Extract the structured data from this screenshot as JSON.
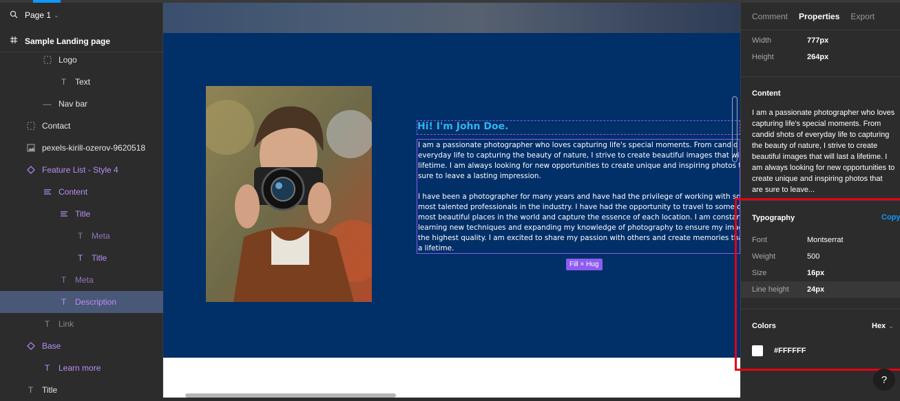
{
  "page_selector": {
    "label": "Page 1"
  },
  "frame": {
    "label": "Sample Landing page"
  },
  "layers": [
    {
      "label": "Logo",
      "icon": "dashed-frame-icon"
    },
    {
      "label": "Text",
      "icon": "text-icon"
    },
    {
      "label": "Nav bar",
      "icon": "line-icon"
    },
    {
      "label": "Contact",
      "icon": "dashed-frame-icon"
    },
    {
      "label": "pexels-kirill-ozerov-9620518",
      "icon": "image-icon"
    },
    {
      "label": "Feature List - Style 4",
      "icon": "component-instance-icon"
    },
    {
      "label": "Content",
      "icon": "autolayout-icon"
    },
    {
      "label": "Title",
      "icon": "autolayout-icon"
    },
    {
      "label": "Meta",
      "icon": "text-icon"
    },
    {
      "label": "Title",
      "icon": "text-icon"
    },
    {
      "label": "Meta",
      "icon": "text-icon"
    },
    {
      "label": "Description",
      "icon": "text-icon"
    },
    {
      "label": "Link",
      "icon": "text-icon"
    },
    {
      "label": "Base",
      "icon": "component-instance-icon"
    },
    {
      "label": "Learn more",
      "icon": "text-icon"
    },
    {
      "label": "Title",
      "icon": "text-icon"
    }
  ],
  "canvas": {
    "heading": "Hi! I'm John Doe.",
    "description": "I am a passionate photographer who loves capturing life's special moments. From candid shots of everyday life to capturing the beauty of nature, I strive to create beautiful images that will last a lifetime. I am always looking for new opportunities to create unique and inspiring photos that are sure to leave a lasting impression.\n\nI have been a photographer for many years and have had the privilege of working with some of the most talented professionals in the industry. I have had the opportunity to travel to some of the most beautiful places in the world and capture the essence of each location. I am constantly learning new techniques and expanding my knowledge of photography to ensure my images are of the highest quality. I am excited to share my passion with others and create memories that will last a lifetime.",
    "size_badge": "Fill × Hug"
  },
  "props": {
    "tabs": [
      "Comment",
      "Properties",
      "Export"
    ],
    "active_tab": "Properties",
    "width_label": "Width",
    "width_value": "777px",
    "height_label": "Height",
    "height_value": "264px",
    "content_title": "Content",
    "content_text": "I am a passionate photographer who loves capturing life's special moments. From candid shots of everyday life to capturing the beauty of nature, I strive to create beautiful images that will last a lifetime. I am always looking for new opportunities to create unique and inspiring photos that are sure to leave...",
    "typography_title": "Typography",
    "copy_label": "Copy",
    "font_label": "Font",
    "font_value": "Montserrat",
    "weight_label": "Weight",
    "weight_value": "500",
    "size_label": "Size",
    "size_value": "16px",
    "line_height_label": "Line height",
    "line_height_value": "24px",
    "colors_title": "Colors",
    "color_format": "Hex",
    "color_value": "#FFFFFF"
  },
  "help": {
    "label": "?"
  },
  "colors": {
    "canvas_blue": "#012f68",
    "heading_blue": "#2fb4ef",
    "selection": "#8e5cf0",
    "accent": "#0d99ff",
    "highlight": "#e60012"
  }
}
